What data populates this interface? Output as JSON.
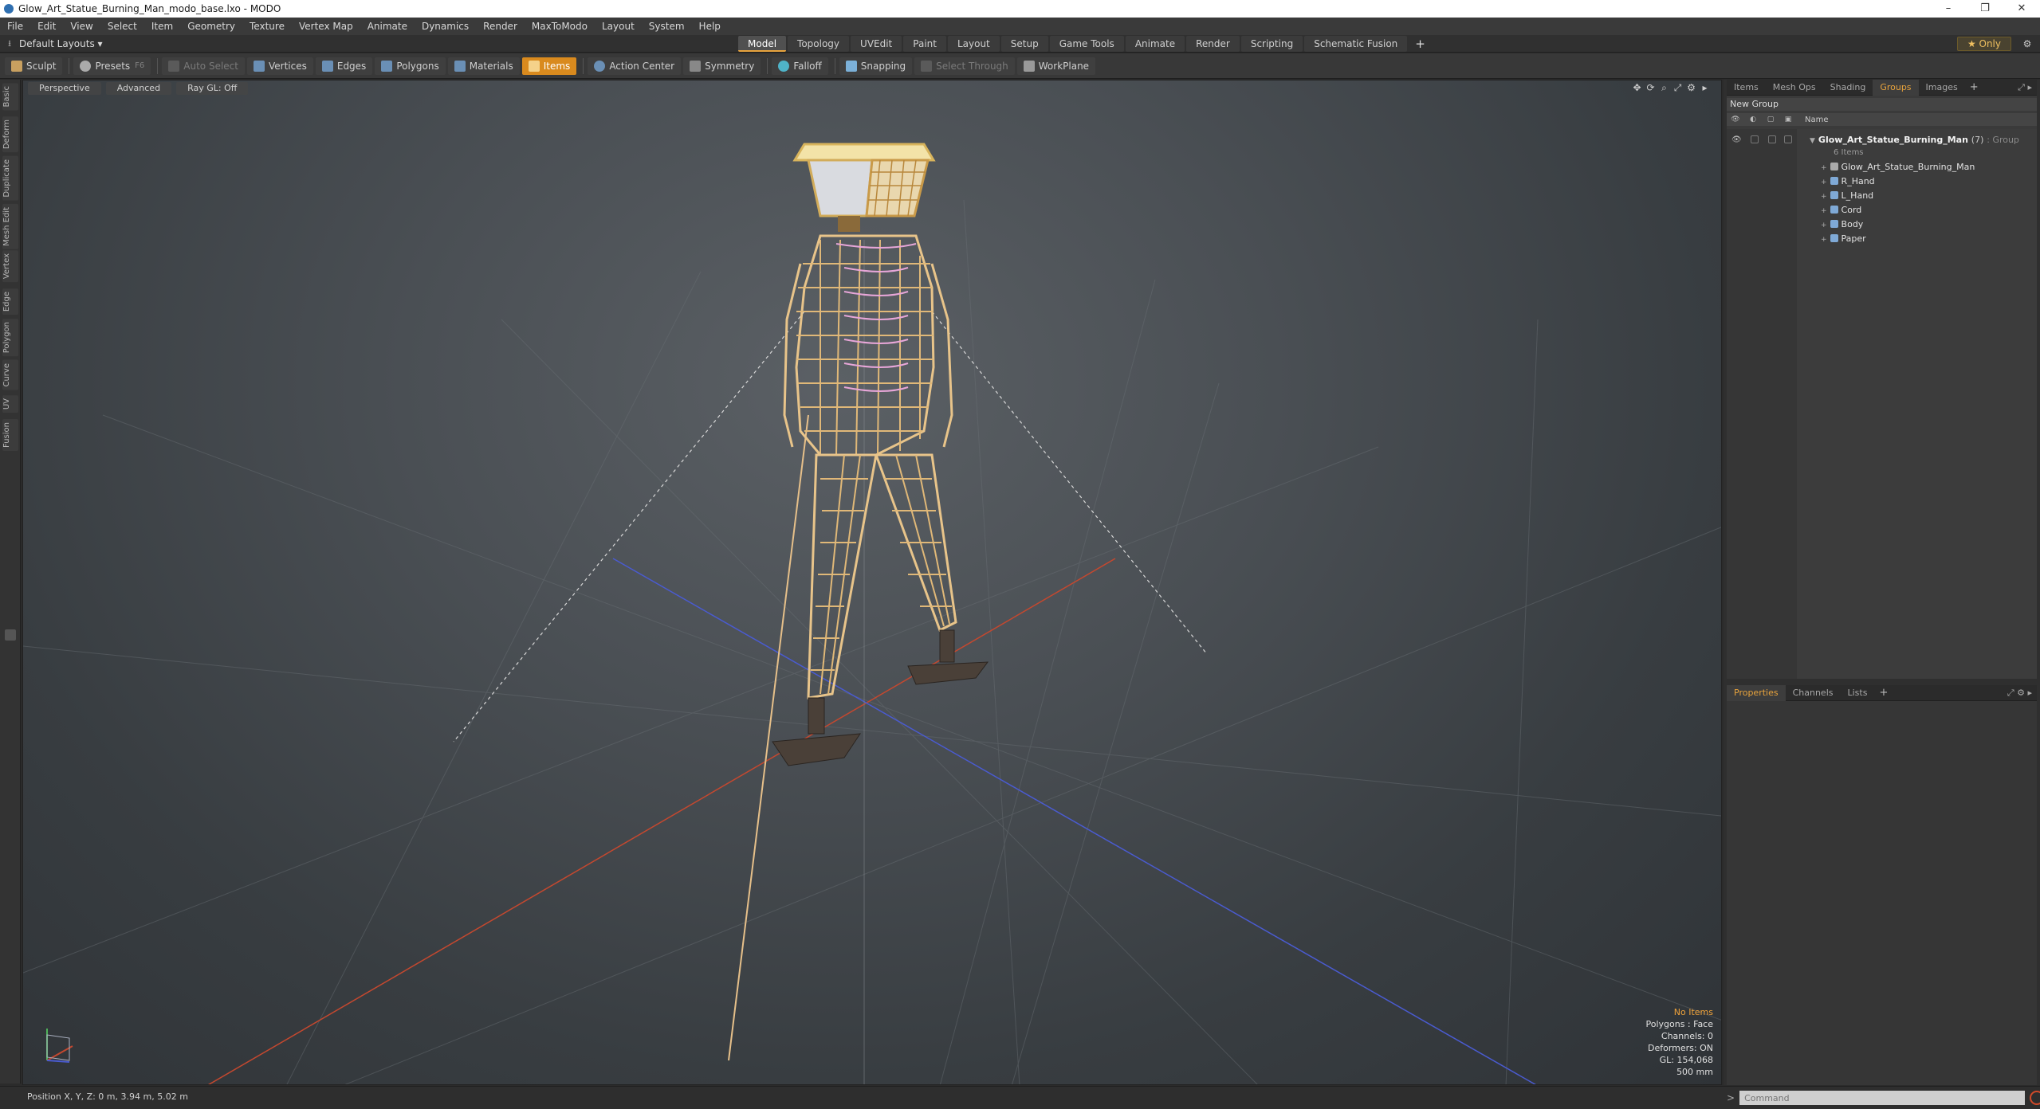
{
  "window": {
    "title": "Glow_Art_Statue_Burning_Man_modo_base.lxo - MODO",
    "minimize": "–",
    "maximize": "❐",
    "close": "✕"
  },
  "menu": [
    "File",
    "Edit",
    "View",
    "Select",
    "Item",
    "Geometry",
    "Texture",
    "Vertex Map",
    "Animate",
    "Dynamics",
    "Render",
    "MaxToModo",
    "Layout",
    "System",
    "Help"
  ],
  "layout": {
    "label": "Default Layouts ▾"
  },
  "modes": [
    {
      "label": "Model",
      "active": true
    },
    {
      "label": "Topology",
      "active": false
    },
    {
      "label": "UVEdit",
      "active": false
    },
    {
      "label": "Paint",
      "active": false
    },
    {
      "label": "Layout",
      "active": false
    },
    {
      "label": "Setup",
      "active": false
    },
    {
      "label": "Game Tools",
      "active": false
    },
    {
      "label": "Animate",
      "active": false
    },
    {
      "label": "Render",
      "active": false
    },
    {
      "label": "Scripting",
      "active": false
    },
    {
      "label": "Schematic Fusion",
      "active": false
    }
  ],
  "mode_plus": "+",
  "only_label": "★ Only",
  "tools": {
    "sculpt": "Sculpt",
    "presets": "Presets",
    "presets_key": "F6",
    "auto_select": "Auto Select",
    "vertices": "Vertices",
    "edges": "Edges",
    "polygons": "Polygons",
    "materials": "Materials",
    "items": "Items",
    "action_center": "Action Center",
    "symmetry": "Symmetry",
    "falloff": "Falloff",
    "snapping": "Snapping",
    "select_through": "Select Through",
    "workplane": "WorkPlane"
  },
  "left_tabs": [
    "Basic",
    "Deform",
    "Duplicate",
    "Mesh Edit",
    "Vertex",
    "Edge",
    "Polygon",
    "Curve",
    "UV",
    "Fusion"
  ],
  "viewport": {
    "view": "Perspective",
    "shading": "Advanced",
    "raygl": "Ray GL: Off",
    "stats": {
      "selection": "No Items",
      "polygons": "Polygons : Face",
      "channels": "Channels: 0",
      "deformers": "Deformers: ON",
      "gl": "GL: 154,068",
      "scale": "500 mm"
    }
  },
  "status": {
    "position": "Position X, Y, Z:  0 m, 3.94 m, 5.02 m",
    "command_placeholder": "Command",
    "cmd_arrow": ">"
  },
  "groups_panel": {
    "tabs": [
      {
        "label": "Items",
        "active": false
      },
      {
        "label": "Mesh Ops",
        "active": false
      },
      {
        "label": "Shading",
        "active": false
      },
      {
        "label": "Groups",
        "active": true
      },
      {
        "label": "Images",
        "active": false
      }
    ],
    "plus": "+",
    "new_group": "New Group",
    "name_header": "Name",
    "group": {
      "name": "Glow_Art_Statue_Burning_Man",
      "count": "(7)",
      "kind": ": Group",
      "items_count": "6 Items"
    },
    "children": [
      "Glow_Art_Statue_Burning_Man",
      "R_Hand",
      "L_Hand",
      "Cord",
      "Body",
      "Paper"
    ]
  },
  "props_panel": {
    "tabs": [
      {
        "label": "Properties",
        "active": true
      },
      {
        "label": "Channels",
        "active": false
      },
      {
        "label": "Lists",
        "active": false
      }
    ],
    "plus": "+"
  },
  "colors": {
    "accent": "#e8a33d",
    "active_tool": "#d98a1e",
    "statue_wood": "#e6c08a",
    "axis_x": "#c4482f",
    "axis_z": "#4a5bd0"
  }
}
